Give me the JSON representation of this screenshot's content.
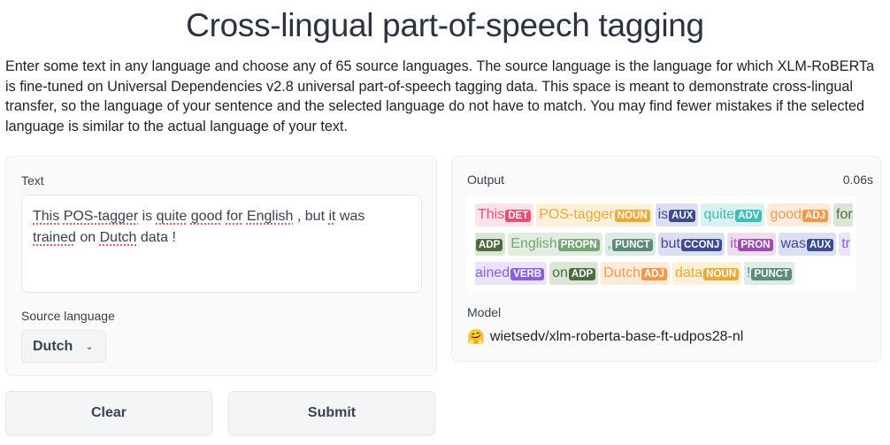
{
  "title": "Cross-lingual part-of-speech tagging",
  "description": "Enter some text in any language and choose any of 65 source languages. The source language is the language for which XLM-RoBERTa is fine-tuned on Universal Dependencies v2.8 universal part-of-speech tagging data. This space is meant to demonstrate cross-lingual transfer, so the language of your sentence and the selected language do not have to match. You may find fewer mistakes if the selected language is similar to the actual language of your text.",
  "input": {
    "text_label": "Text",
    "text_value": "This POS-tagger is quite good for English , but it was trained on Dutch data !",
    "language_label": "Source language",
    "language_value": "Dutch"
  },
  "output": {
    "label": "Output",
    "time": "0.06s",
    "tokens": [
      {
        "word": "This",
        "tag": "DET",
        "bg": "#fde2e8",
        "fg": "#e9517a",
        "tagbg": "#ec4c76"
      },
      {
        "word": "POS-tagger",
        "tag": "NOUN",
        "bg": "#fdf0d8",
        "fg": "#eda935",
        "tagbg": "#eca934"
      },
      {
        "word": "is",
        "tag": "AUX",
        "bg": "#dcdff0",
        "fg": "#3d4a91",
        "tagbg": "#3d4a91"
      },
      {
        "word": "quite",
        "tag": "ADV",
        "bg": "#d9f2f1",
        "fg": "#3dbdb8",
        "tagbg": "#3dbdb8"
      },
      {
        "word": "good",
        "tag": "ADJ",
        "bg": "#feebdc",
        "fg": "#f59a4c",
        "tagbg": "#f5964a"
      },
      {
        "word": "for",
        "tag": "ADP",
        "bg": "#dde5d8",
        "fg": "#4d6b3d",
        "tagbg": "#4d6b3d"
      },
      {
        "word": "English",
        "tag": "PROPN",
        "bg": "#e1ede0",
        "fg": "#79a476",
        "tagbg": "#79a476"
      },
      {
        "word": ",",
        "tag": "PUNCT",
        "bg": "#dfebe6",
        "fg": "#5d8c7b",
        "tagbg": "#5d8c7b"
      },
      {
        "word": "but",
        "tag": "CCONJ",
        "bg": "#dcdff0",
        "fg": "#3d4a91",
        "tagbg": "#3d4a91"
      },
      {
        "word": "it",
        "tag": "PRON",
        "bg": "#eedcef",
        "fg": "#a05cb0",
        "tagbg": "#9a4fac"
      },
      {
        "word": "was",
        "tag": "AUX",
        "bg": "#dcdff0",
        "fg": "#3d4a91",
        "tagbg": "#3d4a91"
      },
      {
        "word": "trained",
        "tag": "VERB",
        "bg": "#ebe2fb",
        "fg": "#8a5fe0",
        "tagbg": "#8a5fe0"
      },
      {
        "word": "on",
        "tag": "ADP",
        "bg": "#dde5d8",
        "fg": "#4d6b3d",
        "tagbg": "#4d6b3d"
      },
      {
        "word": "Dutch",
        "tag": "ADJ",
        "bg": "#feebdc",
        "fg": "#f59a4c",
        "tagbg": "#f5964a"
      },
      {
        "word": "data",
        "tag": "NOUN",
        "bg": "#fdf0d8",
        "fg": "#eda935",
        "tagbg": "#eca934"
      },
      {
        "word": "!",
        "tag": "PUNCT",
        "bg": "#dfebe6",
        "fg": "#5d8c7b",
        "tagbg": "#5d8c7b"
      }
    ],
    "model_label": "Model",
    "model_icon": "hugging-face-emoji",
    "model_emoji": "🤗",
    "model_name": "wietsedv/xlm-roberta-base-ft-udpos28-nl"
  },
  "buttons": {
    "clear": "Clear",
    "submit": "Submit"
  }
}
